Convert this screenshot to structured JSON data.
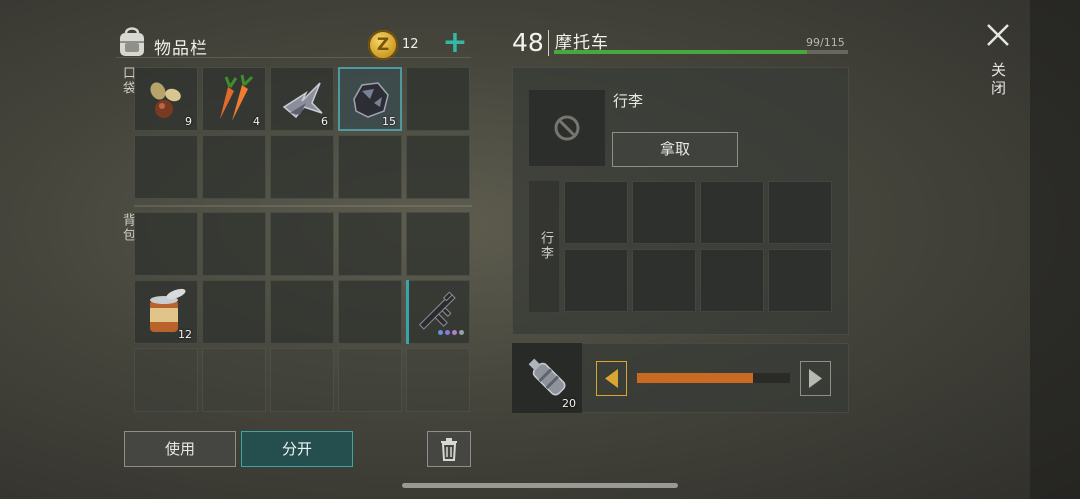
{
  "inventory": {
    "title": "物品栏",
    "coins": "12",
    "coin_symbol": "Z",
    "add_symbol": "+",
    "pocket_label": "口袋",
    "backpack_label": "背包",
    "pocket_items": [
      {
        "name": "seeds",
        "qty": "9"
      },
      {
        "name": "carrots",
        "qty": "4"
      },
      {
        "name": "metal-scraps",
        "qty": "6"
      },
      {
        "name": "coal-ore",
        "qty": "15"
      }
    ],
    "backpack_items": [
      {
        "name": "canned-food",
        "qty": "12"
      },
      {
        "name": "assault-rifle",
        "qty": ""
      }
    ],
    "use_label": "使用",
    "split_label": "分开"
  },
  "vehicle": {
    "level": "48",
    "name": "摩托车",
    "durability": "99/115",
    "durability_fraction": 0.86,
    "luggage_title": "行李",
    "take_label": "拿取",
    "luggage_side_label": "行李",
    "fuel_item_qty": "20",
    "fuel_fraction": 0.76
  },
  "close_label": "关闭",
  "colors": {
    "accent_teal": "#3aa7a1",
    "durability_green": "#48a83d",
    "fuel_orange": "#c96a22",
    "arrow_gold": "#d9a634"
  }
}
